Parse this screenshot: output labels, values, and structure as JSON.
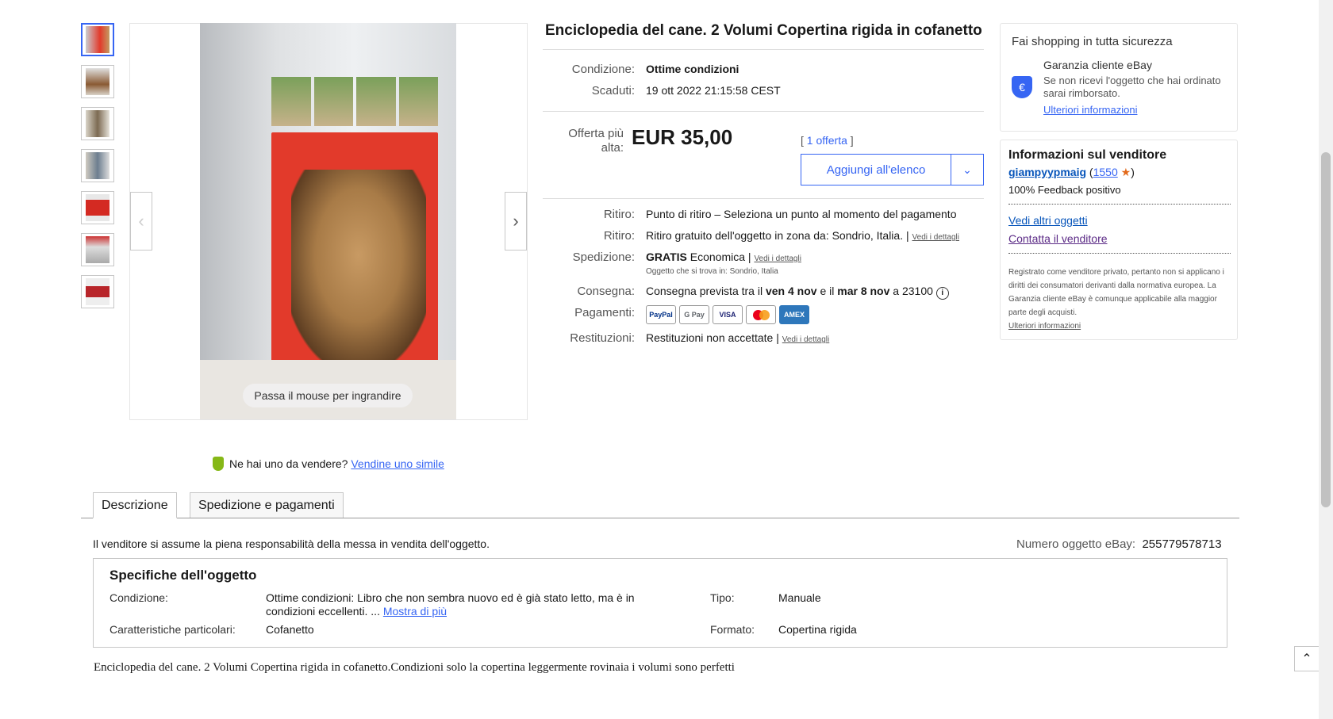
{
  "gallery": {
    "thumb_count": 7,
    "zoom_hint": "Passa il mouse per ingrandire",
    "prev_icon": "‹",
    "next_icon": "›"
  },
  "item": {
    "title": "Enciclopedia del cane. 2 Volumi Copertina rigida in cofanetto",
    "condition_label": "Condizione:",
    "condition_value": "Ottime condizioni",
    "ended_label": "Scaduti:",
    "ended_value": "19 ott 2022  21:15:58 CEST",
    "bid_label": "Offerta più alta:",
    "bid_value": "EUR 35,00",
    "bids_link": "1 offerta",
    "add_to_list": "Aggiungi all'elenco",
    "pickup1_label": "Ritiro:",
    "pickup1_value": "Punto di ritiro – Seleziona un punto al momento del pagamento",
    "pickup2_label": "Ritiro:",
    "pickup2_value": "Ritiro gratuito dell'oggetto in zona da: Sondrio, Italia.",
    "pickup2_link": "Vedi i dettagli",
    "shipping_label": "Spedizione:",
    "shipping_free": "GRATIS",
    "shipping_type": "Economica",
    "shipping_link": "Vedi i dettagli",
    "shipping_location": "Oggetto che si trova in: Sondrio, Italia",
    "delivery_label": "Consegna:",
    "delivery_text": "Consegna prevista tra il",
    "delivery_from": "ven 4 nov",
    "delivery_and": "e il",
    "delivery_to": "mar 8 nov",
    "delivery_zip": "a 23100",
    "payments_label": "Pagamenti:",
    "payment_methods": [
      "PayPal",
      "G Pay",
      "VISA",
      "MC",
      "AMEX"
    ],
    "returns_label": "Restituzioni:",
    "returns_value": "Restituzioni non accettate",
    "returns_link": "Vedi i dettagli"
  },
  "guarantee": {
    "title": "Fai shopping in tutta sicurezza",
    "heading": "Garanzia cliente eBay",
    "text": "Se non ricevi l'oggetto che hai ordinato sarai rimborsato.",
    "link": "Ulteriori informazioni"
  },
  "seller": {
    "title": "Informazioni sul venditore",
    "name": "giampyypmaig",
    "score": "1550",
    "feedback": "100% Feedback positivo",
    "other_items": "Vedi altri oggetti",
    "contact": "Contatta il venditore",
    "notice": "Registrato come venditore privato, pertanto non si applicano i diritti dei consumatori derivanti dalla normativa europea. La Garanzia cliente eBay è comunque applicabile alla maggior parte degli acquisti.",
    "notice_link": "Ulteriori informazioni"
  },
  "sell_prompt": {
    "text": "Ne hai uno da vendere?",
    "link": "Vendine uno simile"
  },
  "tabs": [
    {
      "label": "Descrizione"
    },
    {
      "label": "Spedizione e pagamenti"
    }
  ],
  "description": {
    "responsibility": "Il venditore si assume la piena responsabilità della messa in vendita dell'oggetto.",
    "item_number_label": "Numero oggetto eBay:",
    "item_number": "255779578713",
    "specs_title": "Specifiche dell'oggetto",
    "spec_condition_label": "Condizione:",
    "spec_condition_value": "Ottime condizioni: Libro che non sembra nuovo ed è già stato letto, ma è in condizioni eccellenti. ...",
    "spec_more_link": "Mostra di più",
    "spec_features_label": "Caratteristiche particolari:",
    "spec_features_value": "Cofanetto",
    "spec_type_label": "Tipo:",
    "spec_type_value": "Manuale",
    "spec_format_label": "Formato:",
    "spec_format_value": "Copertina rigida",
    "body": "Enciclopedia del cane. 2 Volumi Copertina rigida in cofanetto.Condizioni solo la copertina leggermente rovinaia i volumi sono perfetti"
  }
}
